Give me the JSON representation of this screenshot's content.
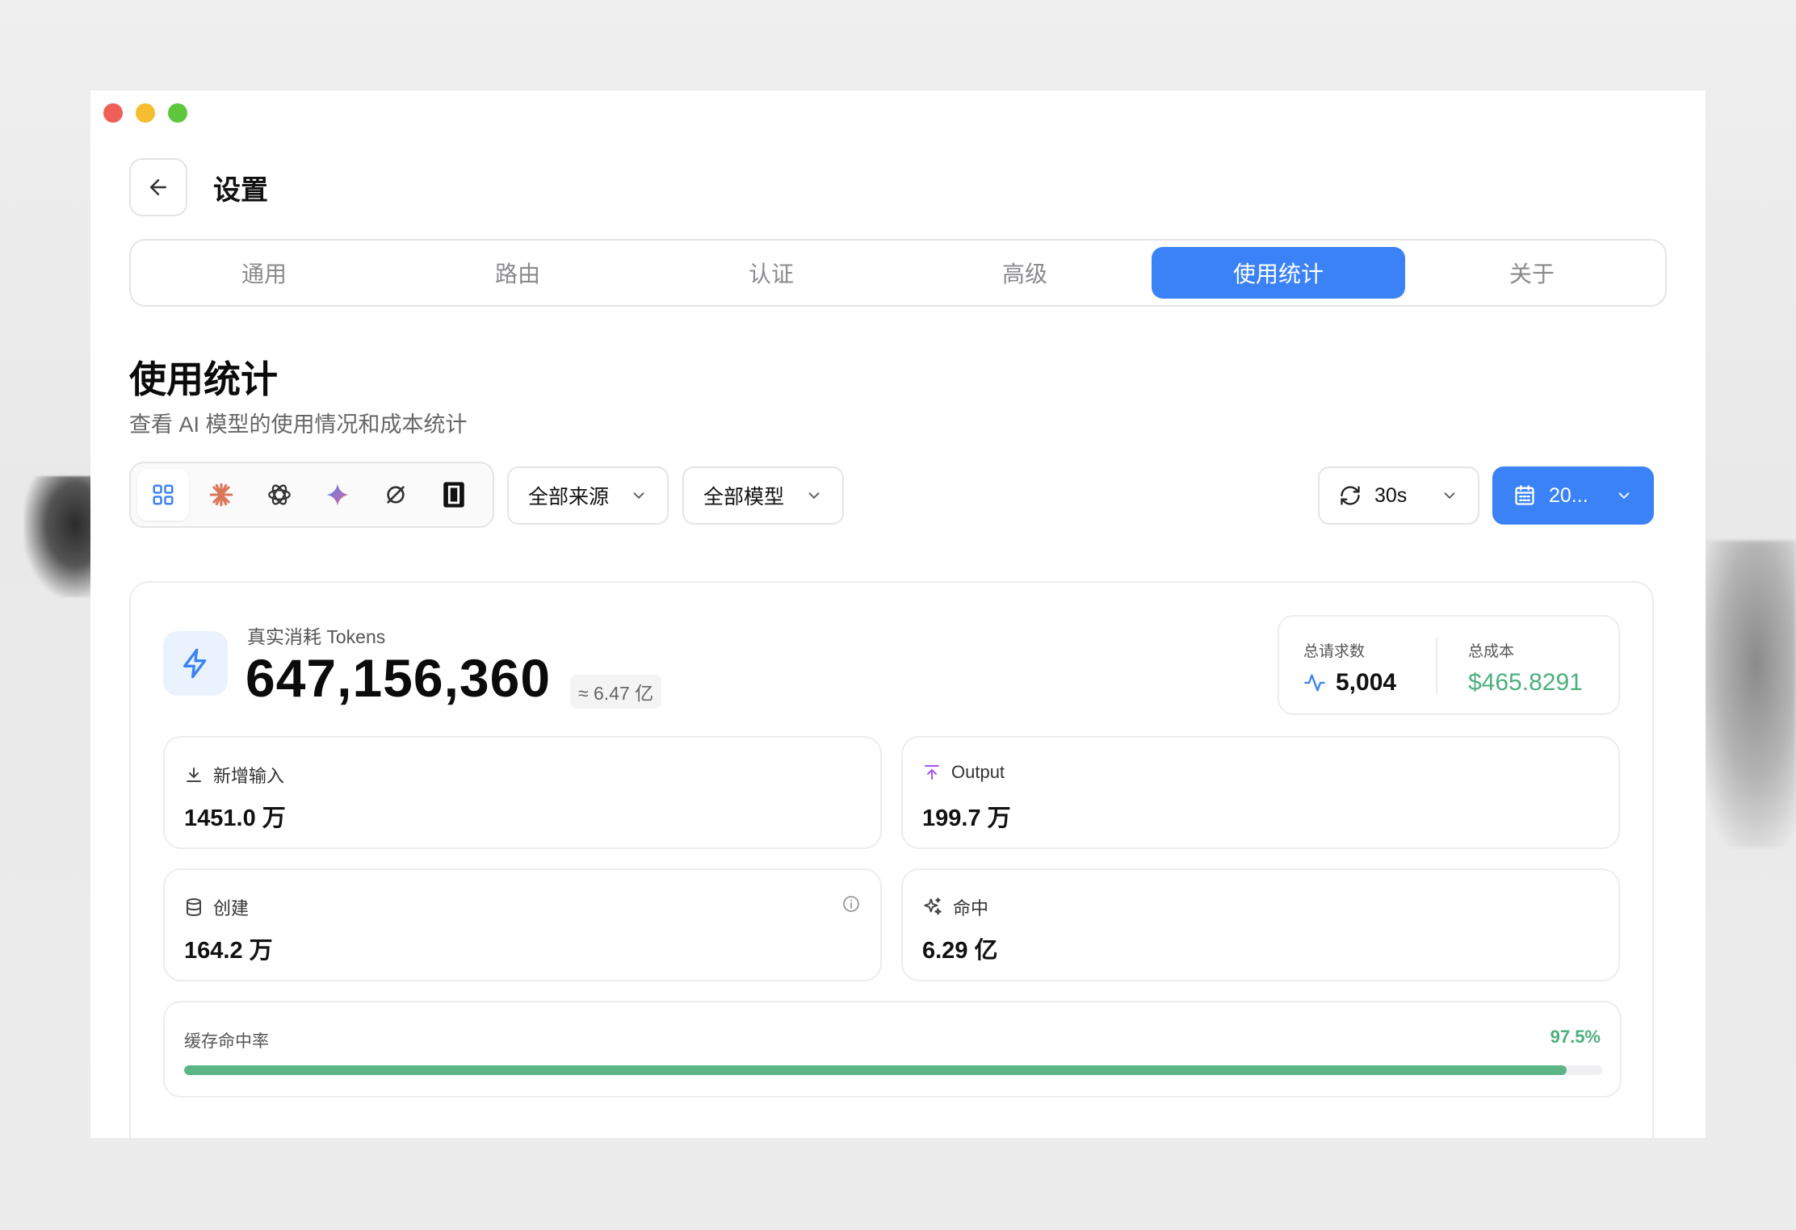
{
  "header": {
    "title": "设置"
  },
  "tabs": [
    {
      "label": "通用"
    },
    {
      "label": "路由"
    },
    {
      "label": "认证"
    },
    {
      "label": "高级"
    },
    {
      "label": "使用统计",
      "active": true
    },
    {
      "label": "关于"
    }
  ],
  "section": {
    "title": "使用统计",
    "subtitle": "查看 AI 模型的使用情况和成本统计"
  },
  "providers": [
    "grid-icon",
    "claude-icon",
    "openai-icon",
    "gemini-icon",
    "sync-icon",
    "kiro-icon"
  ],
  "filters": {
    "source": "全部来源",
    "model": "全部模型",
    "refresh": "30s",
    "date": "20..."
  },
  "tokens": {
    "label": "真实消耗 Tokens",
    "value": "647,156,360",
    "approx": "≈ 6.47 亿"
  },
  "summary": {
    "requests_label": "总请求数",
    "requests_value": "5,004",
    "cost_label": "总成本",
    "cost_value": "$465.8291"
  },
  "metrics": {
    "input": {
      "label": "新增输入",
      "value": "1451.0 万"
    },
    "output": {
      "label": "Output",
      "value": "199.7 万"
    },
    "create": {
      "label": "创建",
      "value": "164.2 万"
    },
    "hit": {
      "label": "命中",
      "value": "6.29 亿"
    }
  },
  "hitrate": {
    "label": "缓存命中率",
    "value": "97.5%",
    "fraction": 0.975
  },
  "colors": {
    "accent": "#3b82f6",
    "success": "#4caf7d"
  }
}
